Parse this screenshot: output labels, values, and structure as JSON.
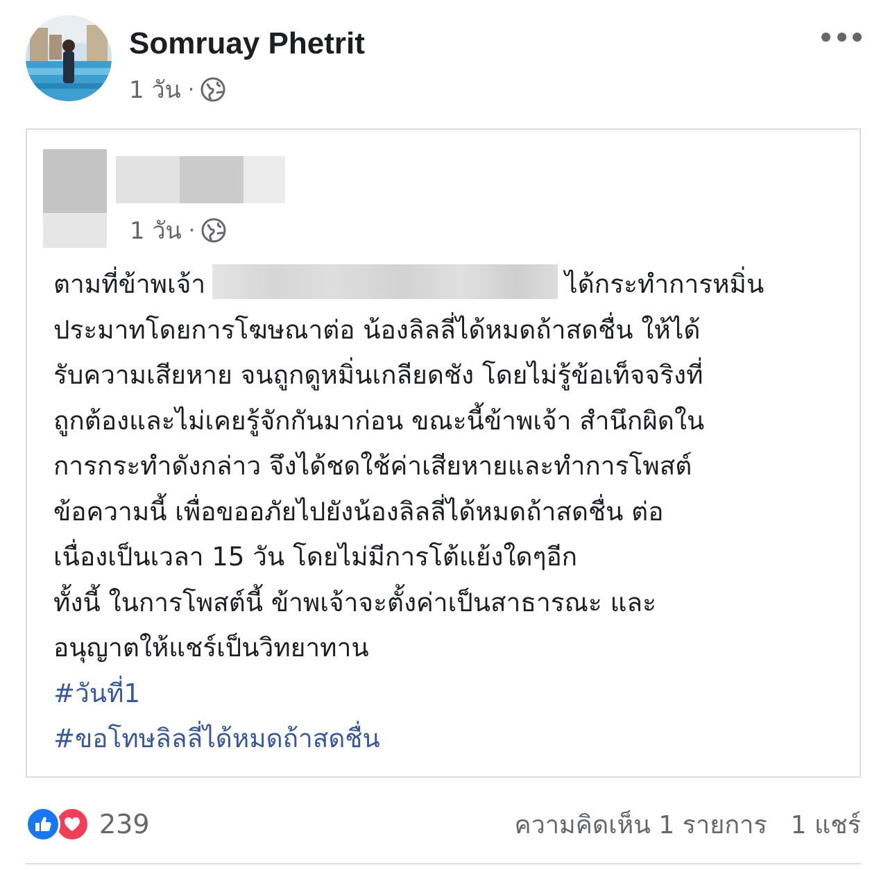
{
  "post": {
    "author_name": "Somruay Phetrit",
    "time": "1 วัน",
    "separator": "·",
    "privacy_icon": "globe-icon",
    "more_icon": "more-options-icon"
  },
  "shared_post": {
    "time": "1 วัน",
    "separator": "·",
    "privacy_icon": "globe-icon",
    "body_lines": [
      "ตามที่ข้าพเจ้า",
      "ได้กระทำการหมิ่น",
      "ประมาทโดยการโฆษณาต่อ น้องลิลลี่ได้หมดถ้าสดชื่น ให้ได้",
      "รับความเสียหาย จนถูกดูหมิ่นเกลียดชัง โดยไม่รู้ข้อเท็จจริงที่",
      "ถูกต้องและไม่เคยรู้จักกันมาก่อน ขณะนี้ข้าพเจ้า สำนึกผิดใน",
      "การกระทำดังกล่าว จึงได้ชดใช้ค่าเสียหายและทำการโพสต์",
      "ข้อความนี้ เพื่อขออภัยไปยังน้องลิลลี่ได้หมดถ้าสดชื่น ต่อ",
      "เนื่องเป็นเวลา 15 วัน โดยไม่มีการโต้แย้งใดๆอีก",
      "ทั้งนี้ ในการโพสต์นี้ ข้าพเจ้าจะตั้งค่าเป็นสาธารณะ และ",
      "อนุญาตให้แชร์เป็นวิทยาทาน"
    ],
    "hashtags": [
      "#วันที่1",
      "#ขอโทษลิลลี่ได้หมดถ้าสดชื่น"
    ]
  },
  "footer": {
    "reaction_icons": [
      "like-icon",
      "love-icon"
    ],
    "reaction_count": "239",
    "comments": "ความคิดเห็น 1 รายการ",
    "shares": "1 แชร์"
  },
  "colors": {
    "text": "#1c1e21",
    "secondary": "#65676b",
    "hashtag": "#385898",
    "like": "#1877f2",
    "love": "#f33e58",
    "border": "#dadde1"
  }
}
